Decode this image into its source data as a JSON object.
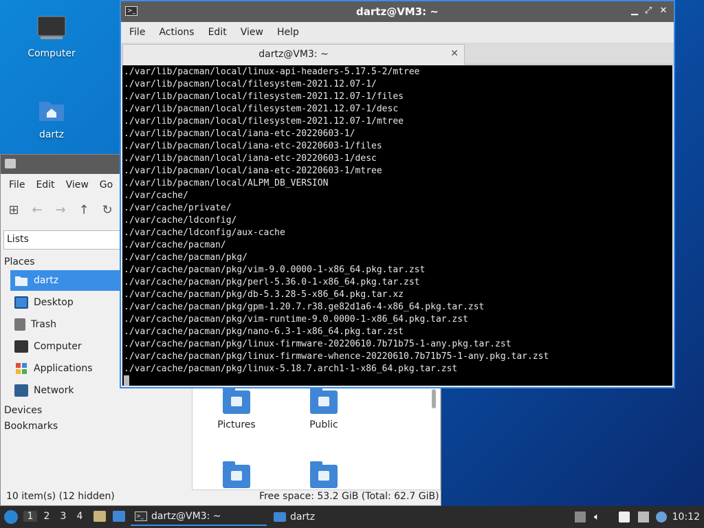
{
  "desktop": {
    "icons": [
      {
        "label": "Computer",
        "icon": "computer-monitor-icon"
      },
      {
        "label": "dartz",
        "icon": "home-folder-icon"
      }
    ]
  },
  "terminal": {
    "title": "dartz@VM3: ~",
    "menu": [
      "File",
      "Actions",
      "Edit",
      "View",
      "Help"
    ],
    "tab_label": "dartz@VM3: ~",
    "lines": [
      "./var/lib/pacman/local/linux-api-headers-5.17.5-2/mtree",
      "./var/lib/pacman/local/filesystem-2021.12.07-1/",
      "./var/lib/pacman/local/filesystem-2021.12.07-1/files",
      "./var/lib/pacman/local/filesystem-2021.12.07-1/desc",
      "./var/lib/pacman/local/filesystem-2021.12.07-1/mtree",
      "./var/lib/pacman/local/iana-etc-20220603-1/",
      "./var/lib/pacman/local/iana-etc-20220603-1/files",
      "./var/lib/pacman/local/iana-etc-20220603-1/desc",
      "./var/lib/pacman/local/iana-etc-20220603-1/mtree",
      "./var/lib/pacman/local/ALPM_DB_VERSION",
      "./var/cache/",
      "./var/cache/private/",
      "./var/cache/ldconfig/",
      "./var/cache/ldconfig/aux-cache",
      "./var/cache/pacman/",
      "./var/cache/pacman/pkg/",
      "./var/cache/pacman/pkg/vim-9.0.0000-1-x86_64.pkg.tar.zst",
      "./var/cache/pacman/pkg/perl-5.36.0-1-x86_64.pkg.tar.zst",
      "./var/cache/pacman/pkg/db-5.3.28-5-x86_64.pkg.tar.xz",
      "./var/cache/pacman/pkg/gpm-1.20.7.r38.ge82d1a6-4-x86_64.pkg.tar.zst",
      "./var/cache/pacman/pkg/vim-runtime-9.0.0000-1-x86_64.pkg.tar.zst",
      "./var/cache/pacman/pkg/nano-6.3-1-x86_64.pkg.tar.zst",
      "./var/cache/pacman/pkg/linux-firmware-20220610.7b71b75-1-any.pkg.tar.zst",
      "./var/cache/pacman/pkg/linux-firmware-whence-20220610.7b71b75-1-any.pkg.tar.zst",
      "./var/cache/pacman/pkg/linux-5.18.7.arch1-1-x86_64.pkg.tar.zst"
    ]
  },
  "file_manager": {
    "menu": [
      "File",
      "Edit",
      "View",
      "Go"
    ],
    "side_pane_mode": "Lists",
    "places_heading": "Places",
    "places": [
      {
        "label": "dartz",
        "icon": "home-folder-icon",
        "selected": true
      },
      {
        "label": "Desktop",
        "icon": "desktop-icon"
      },
      {
        "label": "Trash",
        "icon": "trash-icon"
      },
      {
        "label": "Computer",
        "icon": "computer-icon"
      },
      {
        "label": "Applications",
        "icon": "applications-icon"
      },
      {
        "label": "Network",
        "icon": "network-icon"
      }
    ],
    "devices_heading": "Devices",
    "bookmarks_heading": "Bookmarks",
    "folders": [
      {
        "label": "Pictures",
        "icon": "pictures-folder-icon"
      },
      {
        "label": "Public",
        "icon": "public-folder-icon"
      },
      {
        "label": "",
        "icon": "documents-folder-icon"
      },
      {
        "label": "",
        "icon": "videos-folder-icon"
      }
    ],
    "status_items": "10 item(s) (12 hidden)",
    "status_free": "Free space: 53.2 GiB (Total: 62.7 GiB)"
  },
  "taskbar": {
    "workspaces": [
      "1",
      "2",
      "3",
      "4"
    ],
    "active_workspace": "1",
    "tasks": [
      {
        "label": "dartz@VM3: ~",
        "icon": "terminal-icon"
      },
      {
        "label": "dartz",
        "icon": "folder-icon"
      }
    ],
    "clock": "10:12"
  },
  "colors": {
    "accent": "#3a8ee6",
    "titlebar": "#5b5b5b",
    "taskbar": "#2b2b2b",
    "folder": "#3f86d6"
  }
}
